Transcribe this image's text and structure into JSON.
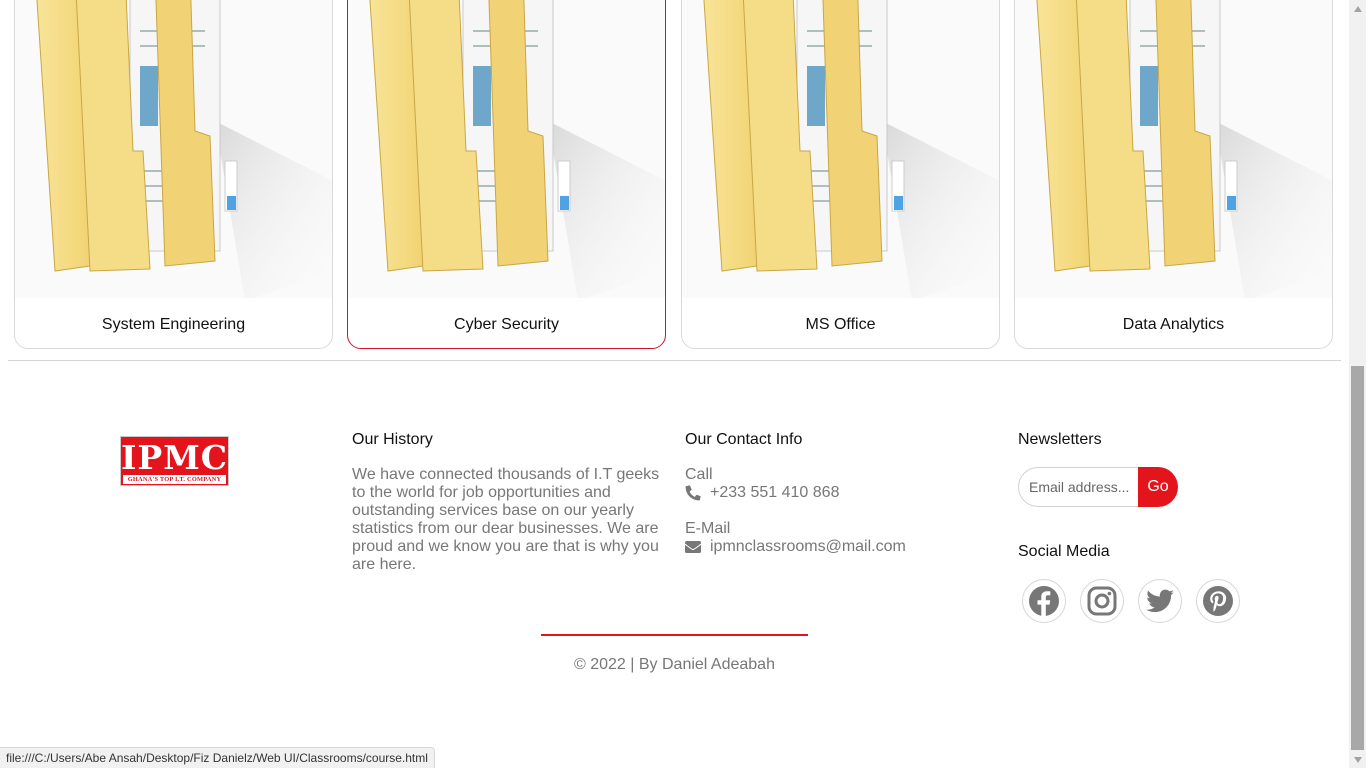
{
  "courses": [
    {
      "title": "System Engineering",
      "icon": "folder-icon"
    },
    {
      "title": "Cyber Security",
      "icon": "folder-icon"
    },
    {
      "title": "MS Office",
      "icon": "folder-icon"
    },
    {
      "title": "Data Analytics",
      "icon": "folder-icon"
    }
  ],
  "logo": {
    "name": "IPMC",
    "tagline": "GHANA'S TOP I.T. COMPANY"
  },
  "history": {
    "heading": "Our History",
    "text": "We have connected thousands of I.T geeks to the world for job opportunities and outstanding services base on our yearly statistics from our dear businesses. We are proud and we know you are that is why you are here."
  },
  "contact": {
    "heading": "Our Contact Info",
    "call_label": "Call",
    "phone": "+233 551 410 868",
    "email_label": "E-Mail",
    "email": "ipmnclassrooms@mail.com"
  },
  "newsletter": {
    "heading": "Newsletters",
    "placeholder": "Email address...",
    "button": "Go"
  },
  "social": {
    "heading": "Social Media",
    "icons": [
      "facebook-icon",
      "instagram-icon",
      "twitter-icon",
      "pinterest-icon"
    ]
  },
  "copyright": "© 2022 | By Daniel Adeabah",
  "status_url": "file:///C:/Users/Abe Ansah/Desktop/Fiz Danielz/Web UI/Classrooms/course.html",
  "colors": {
    "accent": "#e3141b",
    "muted_text": "#777777",
    "folder": "#f3d97b"
  }
}
